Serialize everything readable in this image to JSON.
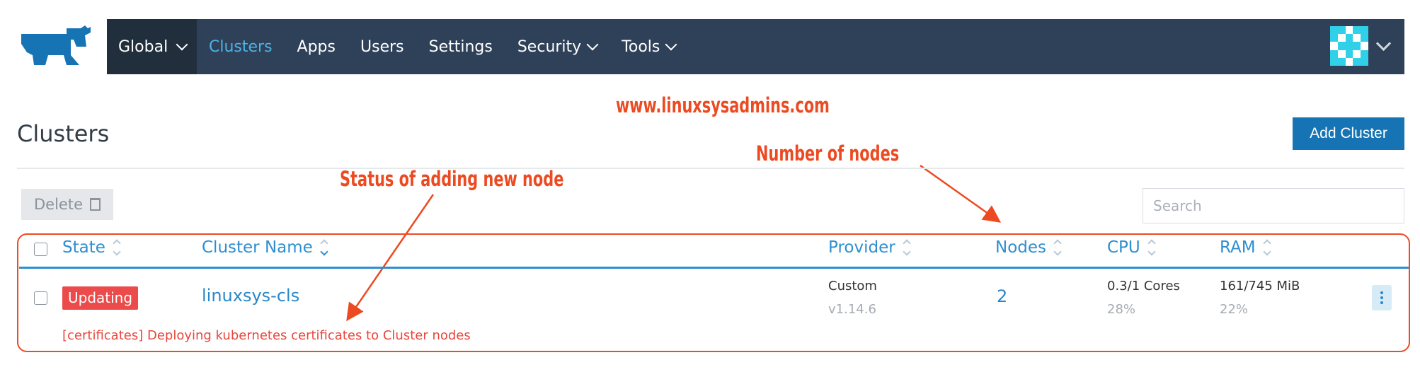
{
  "nav": {
    "scope_label": "Global",
    "items": [
      {
        "label": "Clusters",
        "active": true,
        "dropdown": false
      },
      {
        "label": "Apps",
        "active": false,
        "dropdown": false
      },
      {
        "label": "Users",
        "active": false,
        "dropdown": false
      },
      {
        "label": "Settings",
        "active": false,
        "dropdown": false
      },
      {
        "label": "Security",
        "active": false,
        "dropdown": true
      },
      {
        "label": "Tools",
        "active": false,
        "dropdown": true
      }
    ],
    "logo_icon": "rancher-cow-logo",
    "user_menu_icon": "identicon-avatar"
  },
  "annotations": {
    "watermark": "www.linuxsysadmins.com",
    "nodes_note": "Number of nodes",
    "status_note": "Status of adding new node"
  },
  "page": {
    "title": "Clusters",
    "add_button": "Add Cluster",
    "delete_button": "Delete",
    "search_placeholder": "Search"
  },
  "table": {
    "columns": {
      "state": "State",
      "name": "Cluster Name",
      "provider": "Provider",
      "nodes": "Nodes",
      "cpu": "CPU",
      "ram": "RAM"
    },
    "rows": [
      {
        "state": "Updating",
        "name": "linuxsys-cls",
        "provider": "Custom",
        "version": "v1.14.6",
        "nodes": "2",
        "cpu": "0.3/1 Cores",
        "cpu_pct": "28%",
        "ram": "161/745 MiB",
        "ram_pct": "22%",
        "message": "[certificates] Deploying kubernetes certificates to Cluster nodes"
      }
    ]
  },
  "colors": {
    "nav_bg": "#2f4158",
    "nav_global_bg": "#212f3d",
    "accent": "#2d8fd0",
    "primary_button": "#1674b5",
    "badge_error": "#ec4b4b",
    "annotation": "#ec4a21"
  }
}
